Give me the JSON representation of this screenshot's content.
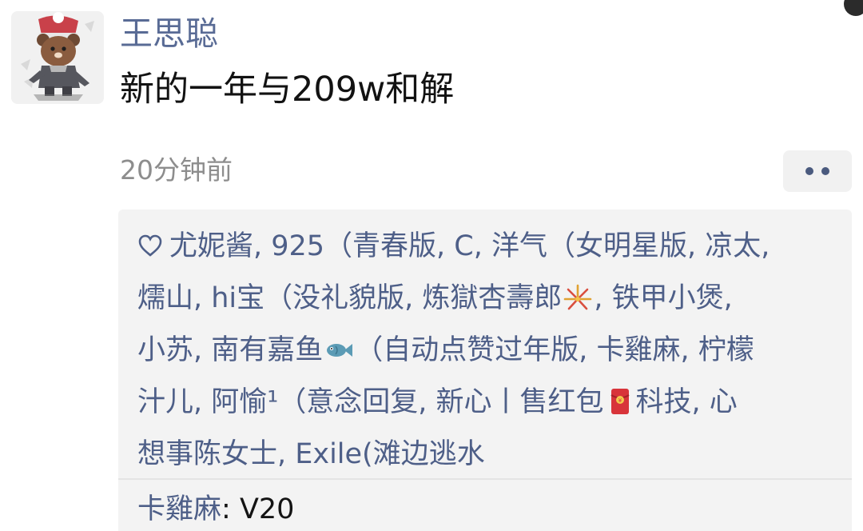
{
  "post": {
    "author_name": "王思聪",
    "text": "新的一年与209w和解",
    "timestamp": "20分钟前",
    "avatar_icon": "bear-avatar-icon",
    "more_icon": "two-dots-icon"
  },
  "likes": {
    "icon": "heart-outline-icon",
    "line_1": "尤妮酱, 925（青春版, C, 洋气（女明星版, 凉太,",
    "line_2a": "燸山, hi宝（没礼貌版, 炼獄杏壽郎",
    "emoji_1": "fireworks-icon",
    "line_2b": ", 铁甲小煲,",
    "line_3a": "小苏, 南有嘉鱼",
    "emoji_2": "fish-icon",
    "line_3b": "（自动点赞过年版, 卡雞麻, 柠檬",
    "line_4a": "汁儿, 阿愉¹（意念回复, 新心丨售红包",
    "emoji_3": "red-envelope-icon",
    "line_4b": "科技, 心",
    "line_5": "想事陈女士, Exile(滩边逃水"
  },
  "comment": {
    "author": "卡雞麻",
    "separator": ": ",
    "text": "V20"
  },
  "colors": {
    "name_blue": "#596b95",
    "link_blue": "#4e5f88",
    "panel_bg": "#f3f3f3",
    "timestamp_gray": "#8d8d8d"
  }
}
